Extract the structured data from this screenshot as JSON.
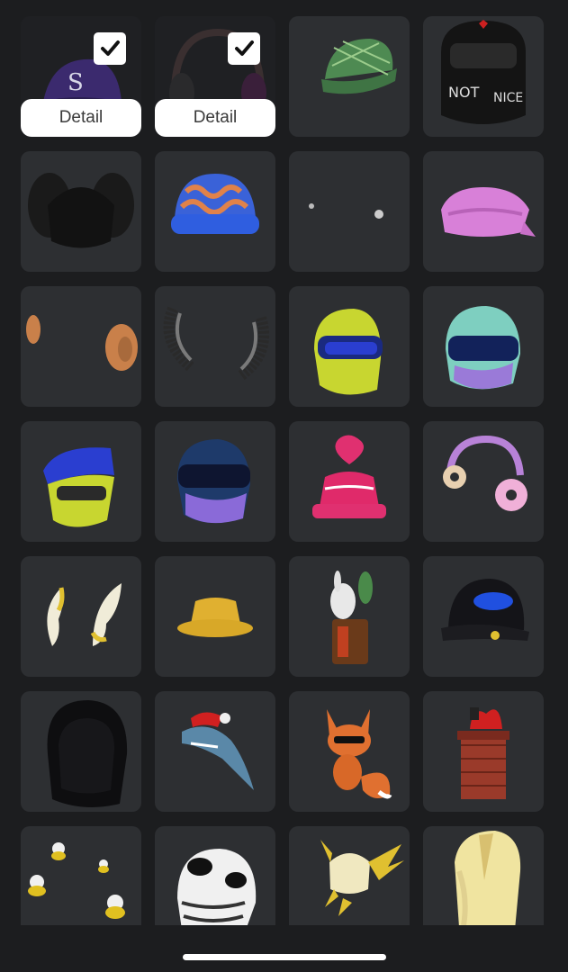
{
  "colors": {
    "background": "#1c1d1f",
    "tile": "#2d2f32",
    "selected_tile": "#1f2023",
    "button": "#ffffff",
    "button_text": "#3a3a3a"
  },
  "items": [
    {
      "name": "purple-cap-accessory",
      "selected": true,
      "detail_label": "Detail"
    },
    {
      "name": "headphones-accessory",
      "selected": true,
      "detail_label": "Detail"
    },
    {
      "name": "green-plaid-cap-accessory",
      "selected": false
    },
    {
      "name": "not-nice-mask-accessory",
      "selected": false,
      "mask_text_1": "NOT",
      "mask_text_2": "NICE"
    },
    {
      "name": "black-knit-hair-accessory",
      "selected": false
    },
    {
      "name": "blue-beanie-accessory",
      "selected": false
    },
    {
      "name": "tiny-earrings-accessory",
      "selected": false
    },
    {
      "name": "pink-bandana-accessory",
      "selected": false
    },
    {
      "name": "ears-accessory",
      "selected": false
    },
    {
      "name": "spiky-horns-accessory",
      "selected": false
    },
    {
      "name": "yellow-racing-helmet-accessory",
      "selected": false
    },
    {
      "name": "teal-racing-helmet-accessory",
      "selected": false
    },
    {
      "name": "open-racing-helmet-accessory",
      "selected": false
    },
    {
      "name": "blue-purple-helmet-accessory",
      "selected": false
    },
    {
      "name": "pink-bucket-hat-accessory",
      "selected": false
    },
    {
      "name": "donut-headphones-accessory",
      "selected": false
    },
    {
      "name": "curved-horns-accessory",
      "selected": false
    },
    {
      "name": "yellow-bucket-hat-accessory",
      "selected": false
    },
    {
      "name": "bunny-statue-accessory",
      "selected": false
    },
    {
      "name": "black-cap-accessory",
      "selected": false
    },
    {
      "name": "black-hood-accessory",
      "selected": false
    },
    {
      "name": "santa-shark-accessory",
      "selected": false
    },
    {
      "name": "fox-accessory",
      "selected": false
    },
    {
      "name": "santa-chimney-accessory",
      "selected": false
    },
    {
      "name": "duck-swarm-accessory",
      "selected": false
    },
    {
      "name": "cow-football-helmet-accessory",
      "selected": false
    },
    {
      "name": "winged-helmet-accessory",
      "selected": false
    },
    {
      "name": "gold-hood-accessory",
      "selected": false
    }
  ]
}
